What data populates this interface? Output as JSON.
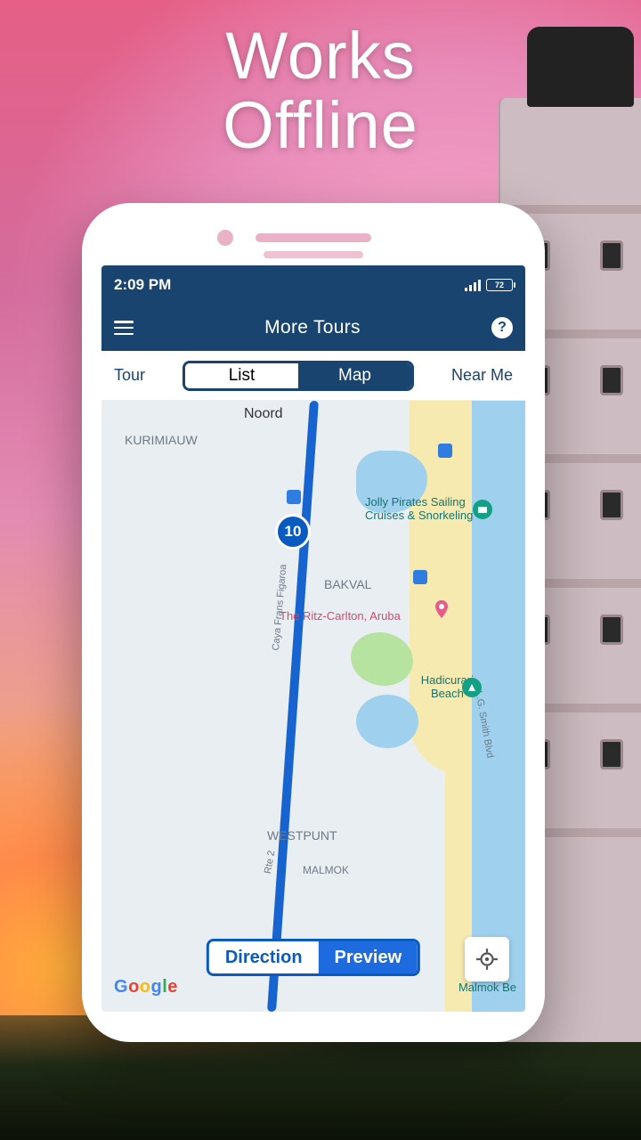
{
  "headline_line1": "Works",
  "headline_line2": "Offline",
  "status": {
    "time": "2:09 PM",
    "battery": "72"
  },
  "header": {
    "title": "More Tours",
    "help": "?"
  },
  "filter": {
    "tour": "Tour",
    "nearme": "Near Me",
    "seg_list": "List",
    "seg_map": "Map"
  },
  "map": {
    "route_number": "10",
    "labels": {
      "noord": "Noord",
      "kurimiauw": "KURIMIAUW",
      "bakval": "BAKVAL",
      "westpunt": "WESTPUNT",
      "malmok": "MALMOK",
      "jolly": "Jolly Pirates Sailing\nCruises & Snorkeling",
      "ritz": "The Ritz-Carlton, Aruba",
      "hadicurari": "Hadicurari\nBeach",
      "malmokbe": "Malmok Be",
      "street1": "Caya Frans Figaroa",
      "street2": "L.G. Smith Blvd",
      "rte": "Rte 2"
    },
    "attribution": "Google"
  },
  "bottom": {
    "direction": "Direction",
    "preview": "Preview"
  }
}
